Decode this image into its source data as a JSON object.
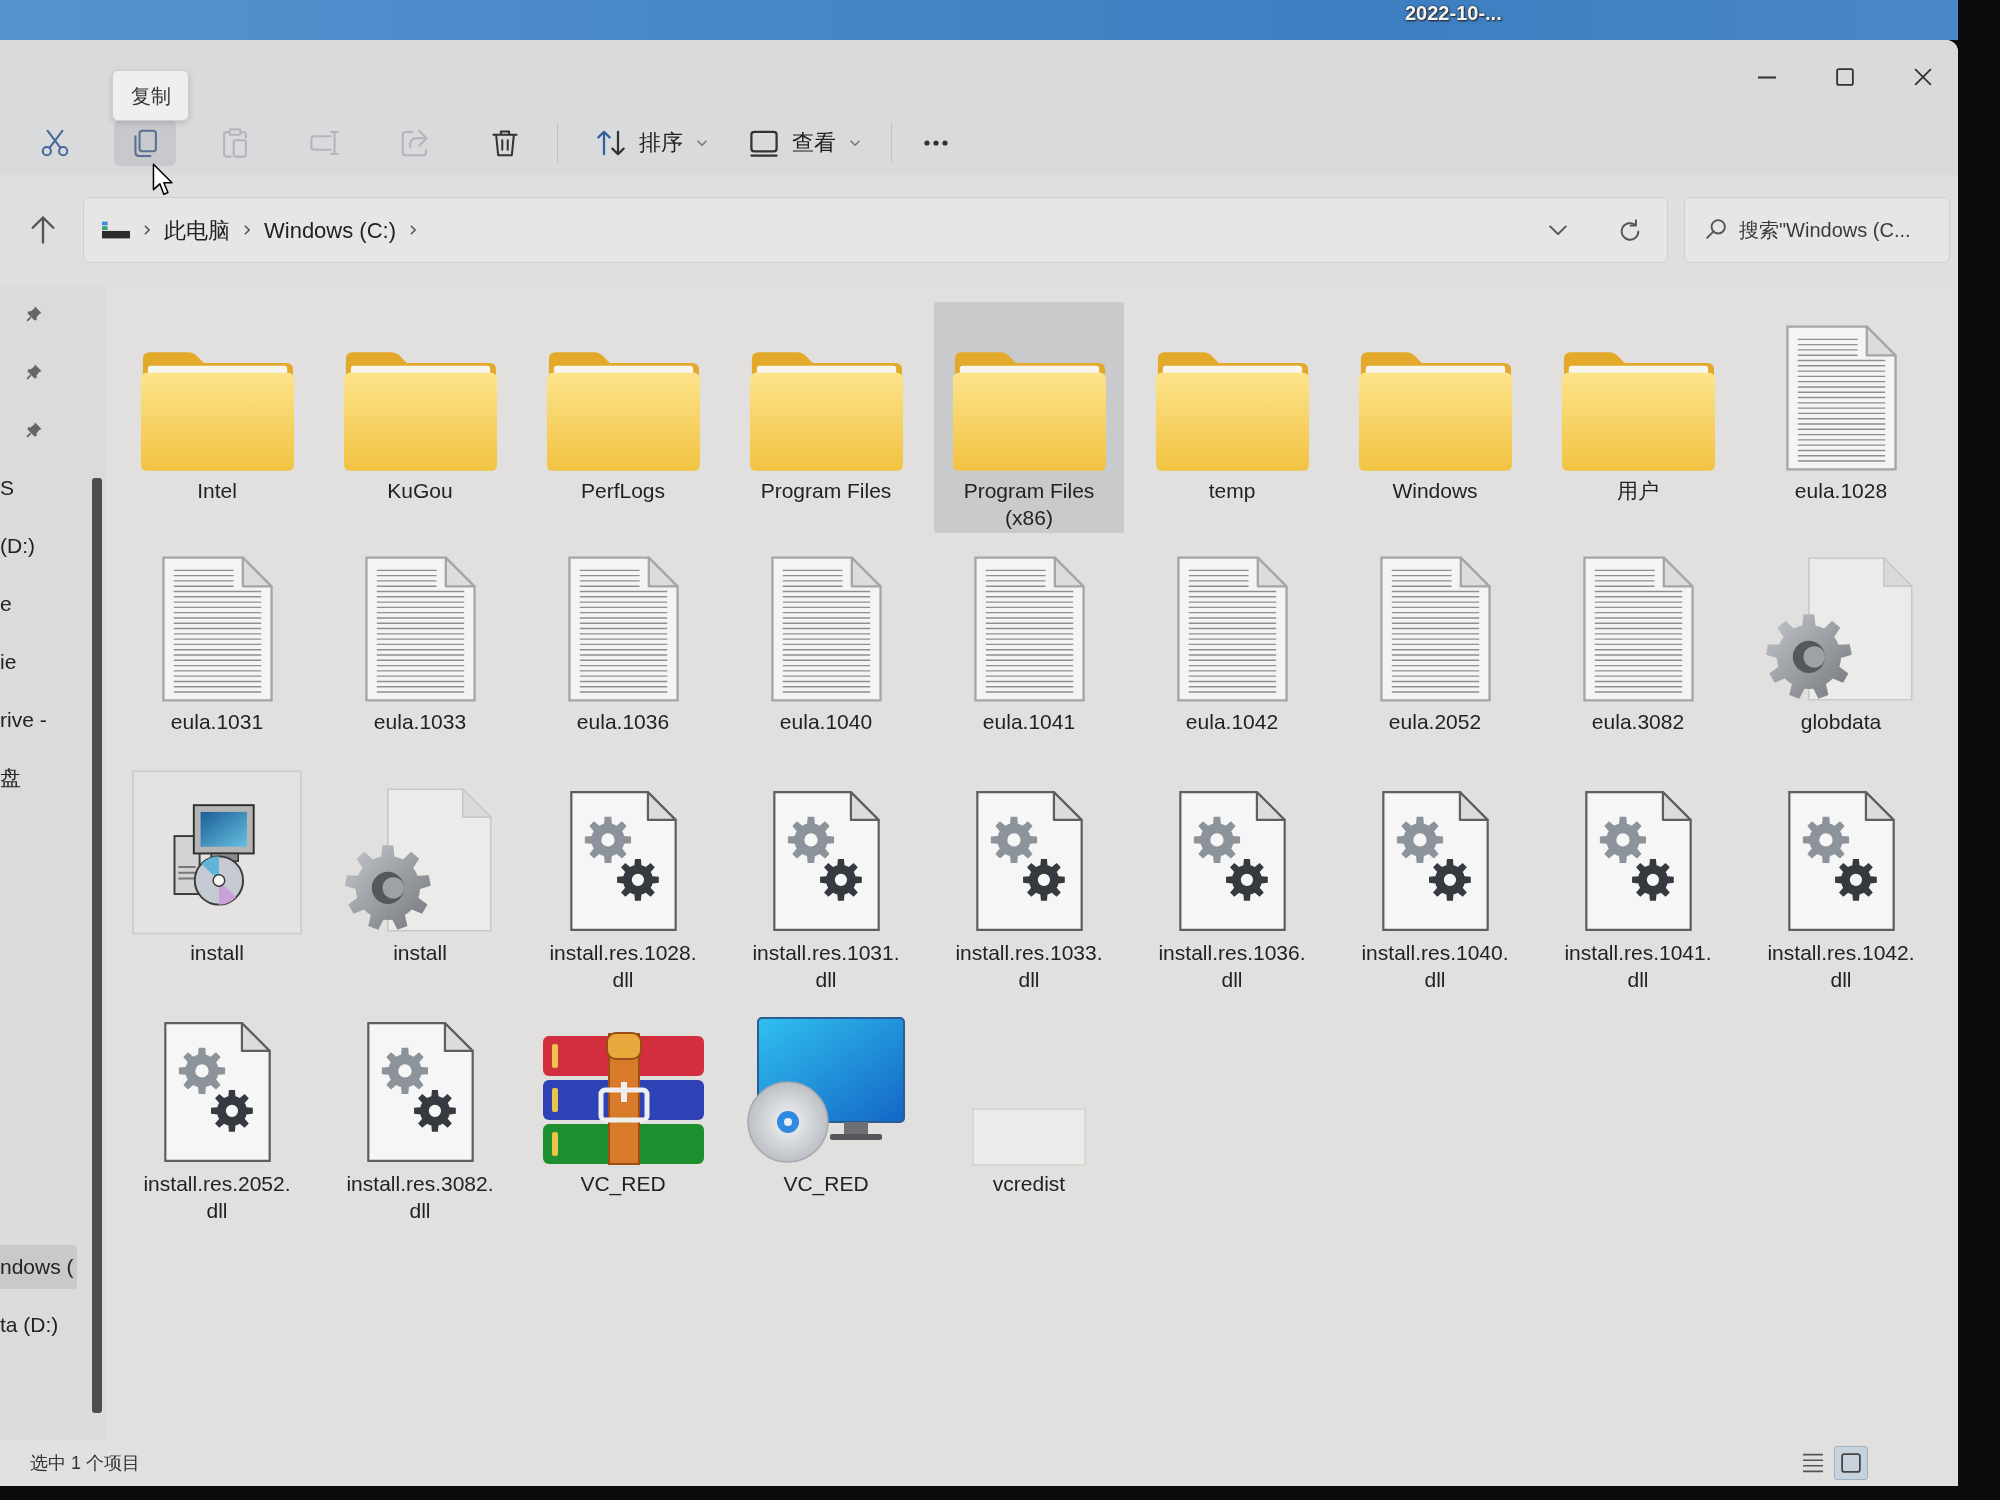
{
  "desktop": {
    "label": "2022-10-..."
  },
  "toolbar": {
    "tooltip": "复制",
    "buttons": [
      {
        "kind": "cut",
        "disabled": false,
        "hovered": false
      },
      {
        "kind": "copy",
        "disabled": false,
        "hovered": true
      },
      {
        "kind": "paste",
        "disabled": true,
        "hovered": false
      },
      {
        "kind": "rename",
        "disabled": true,
        "hovered": false
      },
      {
        "kind": "share",
        "disabled": true,
        "hovered": false
      },
      {
        "kind": "delete",
        "disabled": false,
        "hovered": false
      }
    ],
    "menus": [
      {
        "kind": "sort",
        "label": "排序"
      },
      {
        "kind": "view",
        "label": "查看"
      }
    ]
  },
  "address_bar": {
    "breadcrumb": [
      "此电脑",
      "Windows (C:)"
    ]
  },
  "search": {
    "placeholder": "搜索\"Windows (C..."
  },
  "navigation": {
    "sections": [
      {
        "items": [
          {
            "pinned": true,
            "selected": false
          },
          {
            "pinned": true,
            "selected": false
          },
          {
            "pinned": true,
            "selected": false
          },
          {
            "label": "S",
            "pinned": false,
            "selected": false
          },
          {
            "label": "(D:)",
            "pinned": false,
            "selected": false
          },
          {
            "label": "e",
            "pinned": false,
            "selected": false
          },
          {
            "label": "ie",
            "pinned": false,
            "selected": false
          },
          {
            "label": "rive -",
            "pinned": false,
            "selected": false
          },
          {
            "label": "盘",
            "pinned": false,
            "selected": false
          }
        ]
      },
      {
        "items": [
          {
            "label": "ndows (",
            "pinned": false,
            "selected": true
          },
          {
            "label": "ta (D:)",
            "pinned": false,
            "selected": false
          }
        ]
      }
    ]
  },
  "files": [
    {
      "name": "Intel",
      "kind": "folder",
      "selected": false
    },
    {
      "name": "KuGou",
      "kind": "folder",
      "selected": false
    },
    {
      "name": "PerfLogs",
      "kind": "folder",
      "selected": false
    },
    {
      "name": "Program Files",
      "kind": "folder",
      "selected": false
    },
    {
      "name": "Program Files (x86)",
      "kind": "folder",
      "selected": true
    },
    {
      "name": "temp",
      "kind": "folder",
      "selected": false
    },
    {
      "name": "Windows",
      "kind": "folder",
      "selected": false
    },
    {
      "name": "用户",
      "kind": "folder",
      "selected": false
    },
    {
      "name": "eula.1028",
      "kind": "document",
      "selected": false
    },
    {
      "name": "eula.1031",
      "kind": "document",
      "selected": false
    },
    {
      "name": "eula.1033",
      "kind": "document",
      "selected": false
    },
    {
      "name": "eula.1036",
      "kind": "document",
      "selected": false
    },
    {
      "name": "eula.1040",
      "kind": "document",
      "selected": false
    },
    {
      "name": "eula.1041",
      "kind": "document",
      "selected": false
    },
    {
      "name": "eula.1042",
      "kind": "document",
      "selected": false
    },
    {
      "name": "eula.2052",
      "kind": "document",
      "selected": false
    },
    {
      "name": "eula.3082",
      "kind": "document",
      "selected": false
    },
    {
      "name": "globdata",
      "kind": "gear-file",
      "selected": false
    },
    {
      "name": "install",
      "kind": "setup",
      "selected": false
    },
    {
      "name": "install",
      "kind": "gear-file",
      "selected": false
    },
    {
      "name": "install.res.1028.dll",
      "kind": "dll",
      "selected": false
    },
    {
      "name": "install.res.1031.dll",
      "kind": "dll",
      "selected": false
    },
    {
      "name": "install.res.1033.dll",
      "kind": "dll",
      "selected": false
    },
    {
      "name": "install.res.1036.dll",
      "kind": "dll",
      "selected": false
    },
    {
      "name": "install.res.1040.dll",
      "kind": "dll",
      "selected": false
    },
    {
      "name": "install.res.1041.dll",
      "kind": "dll",
      "selected": false
    },
    {
      "name": "install.res.1042.dll",
      "kind": "dll",
      "selected": false
    },
    {
      "name": "install.res.2052.dll",
      "kind": "dll",
      "selected": false
    },
    {
      "name": "install.res.3082.dll",
      "kind": "dll",
      "selected": false
    },
    {
      "name": "VC_RED",
      "kind": "archive",
      "selected": false
    },
    {
      "name": "VC_RED",
      "kind": "disc-app",
      "selected": false
    },
    {
      "name": "vcredist",
      "kind": "blank",
      "selected": false
    }
  ],
  "status_bar": {
    "text": "选中 1 个项目",
    "views": [
      {
        "kind": "details",
        "selected": false
      },
      {
        "kind": "large-icons",
        "selected": true
      }
    ]
  }
}
